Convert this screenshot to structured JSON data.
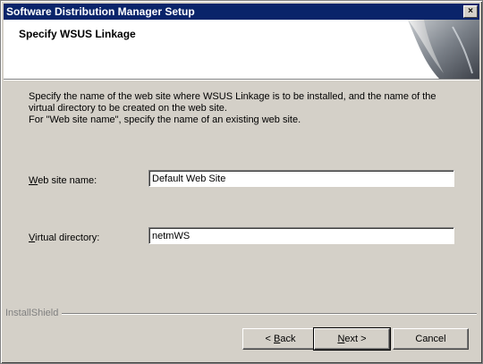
{
  "window": {
    "title": "Software Distribution Manager Setup",
    "close_glyph": "×"
  },
  "header": {
    "heading": "Specify WSUS Linkage"
  },
  "description": {
    "line1": "Specify the name of the web site where WSUS Linkage is to be installed, and the name of the",
    "line2": "virtual directory to be created on the web site.",
    "line3": "For \"Web site name\", specify the name of an existing web site."
  },
  "fields": {
    "website": {
      "label_mnemonic": "W",
      "label_rest": "eb site name:",
      "value": "Default Web Site"
    },
    "vdir": {
      "label_mnemonic": "V",
      "label_rest": "irtual directory:",
      "value": "netmWS"
    }
  },
  "footer": {
    "brand": "InstallShield"
  },
  "buttons": {
    "back": {
      "prefix": "< ",
      "mnemonic": "B",
      "rest": "ack"
    },
    "next": {
      "mnemonic": "N",
      "rest": "ext >"
    },
    "cancel": {
      "label": "Cancel"
    }
  },
  "colors": {
    "titlebar": "#0a246a",
    "face": "#d4d0c8"
  },
  "icons": {
    "header_art": "curled-page-graphic",
    "close": "close-icon"
  }
}
